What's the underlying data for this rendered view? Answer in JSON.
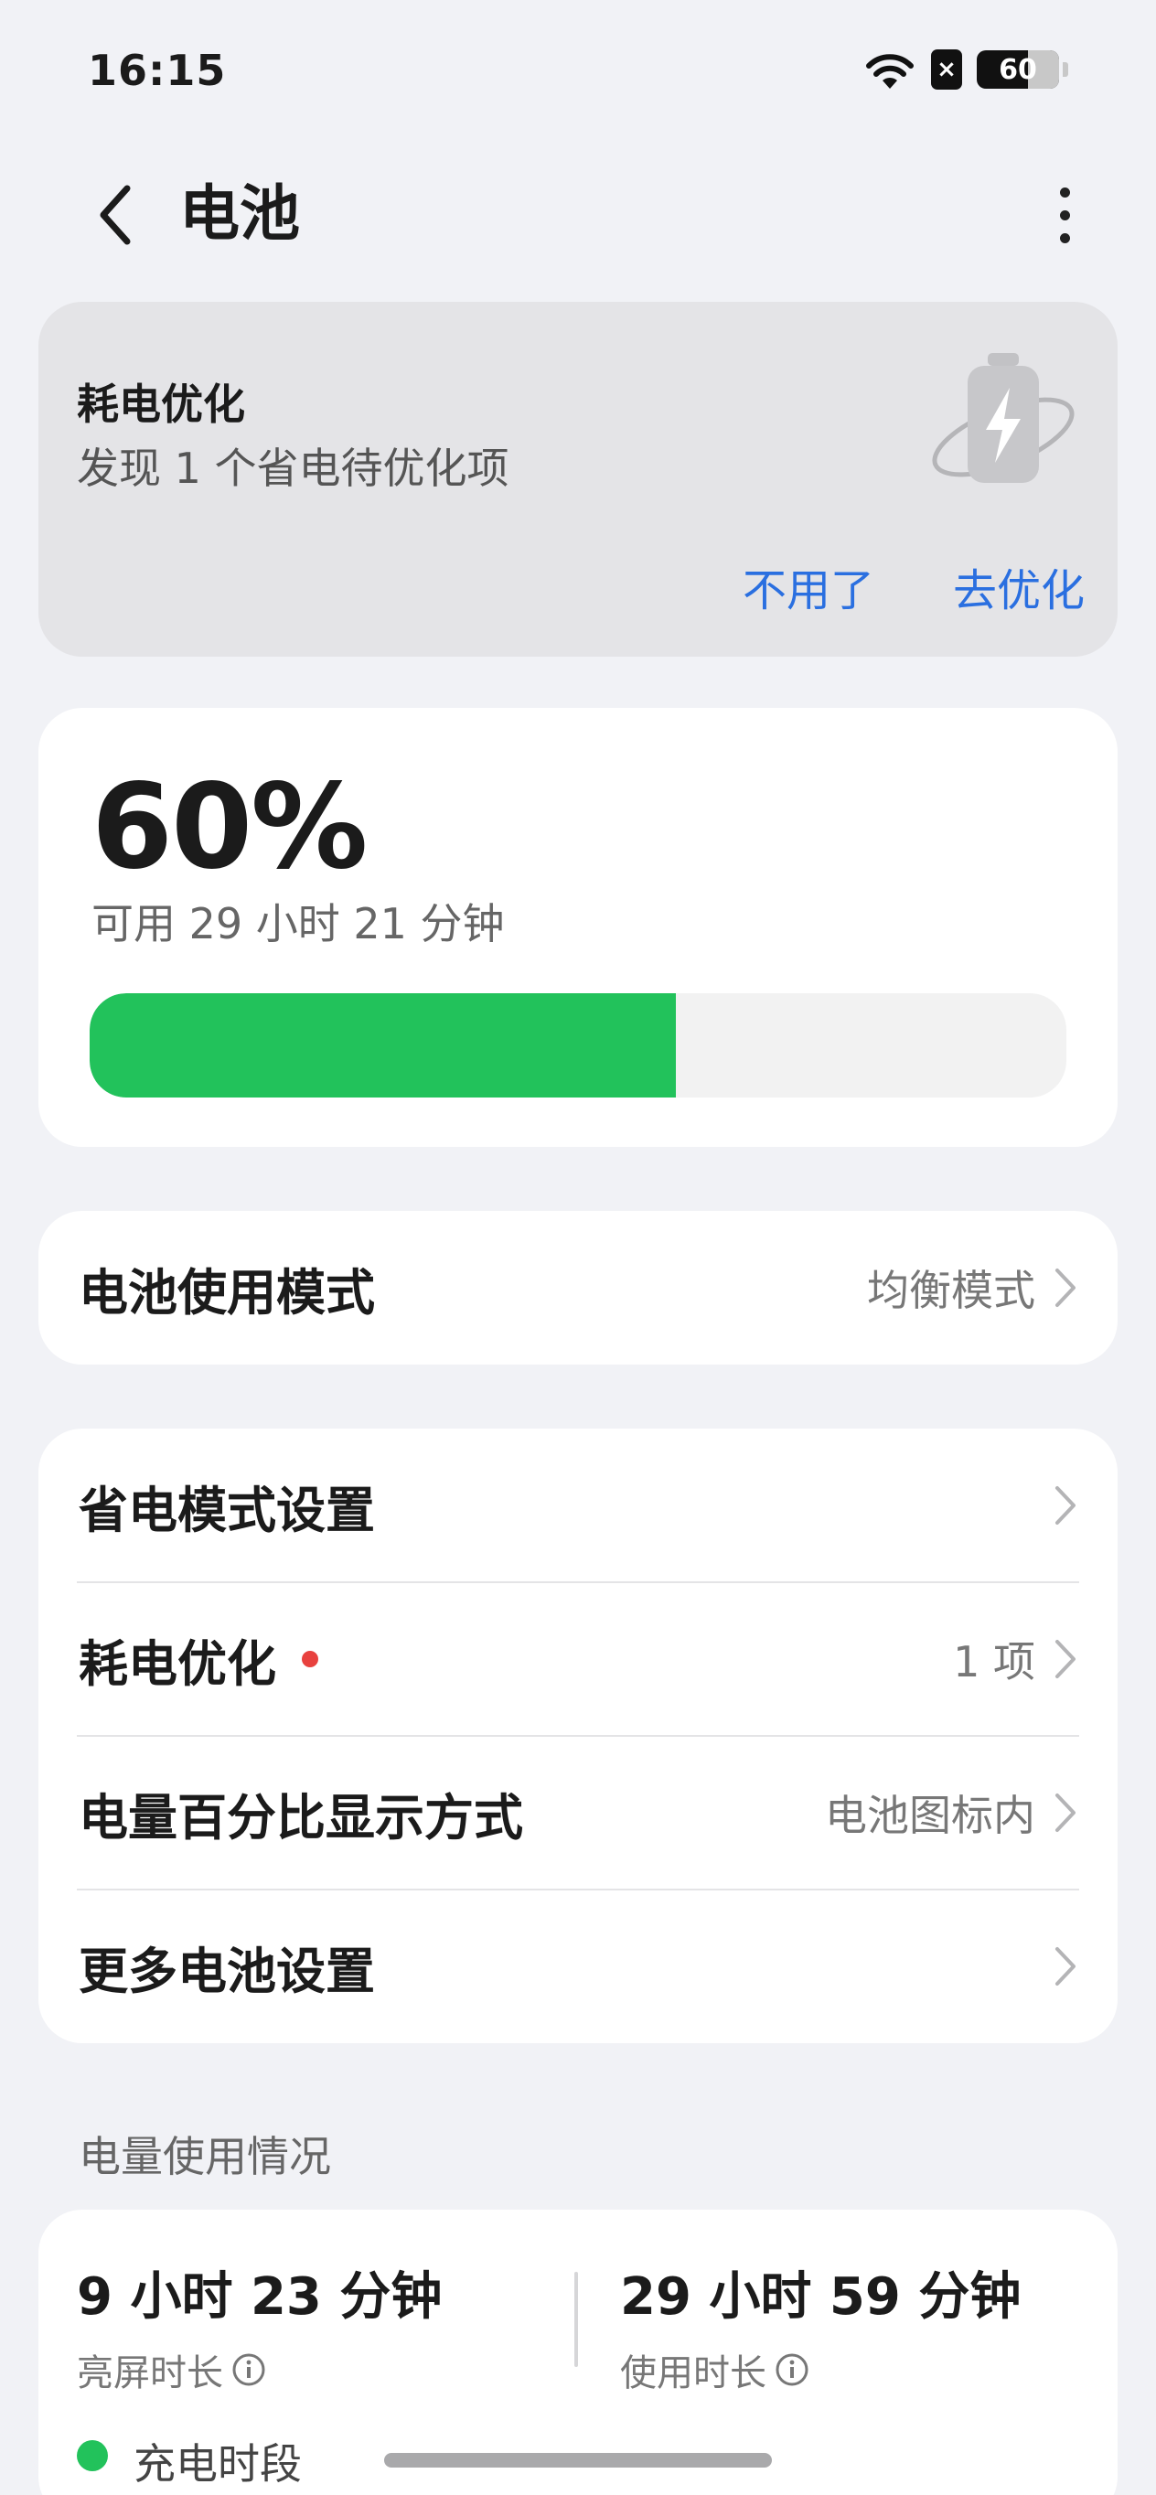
{
  "status_bar": {
    "time": "16:15",
    "battery_level": "60",
    "sim_label": "×",
    "icons": [
      "wifi-icon",
      "sim-icon",
      "battery-icon"
    ]
  },
  "header": {
    "title": "电池",
    "back_icon": "chevron-left-icon",
    "more_icon": "more-vertical-icon"
  },
  "optimization_banner": {
    "title": "耗电优化",
    "description": "发现 1 个省电待优化项",
    "dismiss_label": "不用了",
    "optimize_label": "去优化",
    "accent_color": "#2a6fe0",
    "illustration_icon": "battery-bolt-icon"
  },
  "battery": {
    "percent_text": "60%",
    "level_fraction": 0.6,
    "remaining": "可用 29 小时 21 分钟",
    "bar_color": "#22c25b"
  },
  "mode_row": {
    "label": "电池使用模式",
    "value": "均衡模式"
  },
  "settings_rows": [
    {
      "label": "省电模式设置",
      "value": ""
    },
    {
      "label": "耗电优化",
      "value": "1 项",
      "badge": true
    },
    {
      "label": "电量百分比显示方式",
      "value": "电池图标内"
    },
    {
      "label": "更多电池设置",
      "value": ""
    }
  ],
  "usage": {
    "section_title": "电量使用情况",
    "screen_on_value": "9 小时 23 分钟",
    "screen_on_label": "亮屏时长",
    "usage_value": "29 小时 59 分钟",
    "usage_label": "使用时长",
    "legend_label": "充电时段",
    "legend_color": "#22c25b"
  }
}
